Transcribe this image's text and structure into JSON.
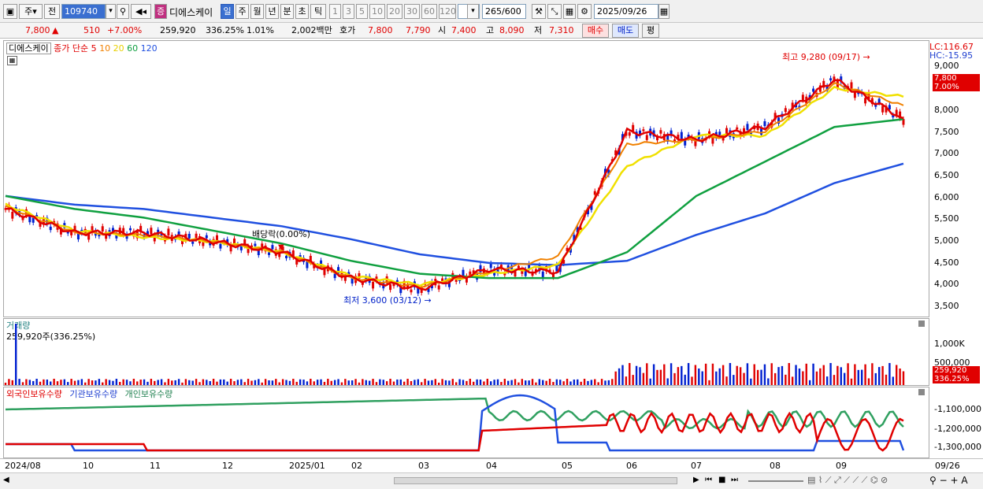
{
  "toolbar": {
    "type1": "주",
    "type2": "전",
    "code": "109740",
    "badge": "증",
    "name": "디에스케이",
    "periods": [
      "일",
      "주",
      "월",
      "년",
      "분",
      "초",
      "틱"
    ],
    "intervals": [
      "1",
      "3",
      "5",
      "10",
      "20",
      "30",
      "60",
      "120"
    ],
    "count": "265",
    "count_total": "/600",
    "date": "2025/09/26"
  },
  "quote": {
    "price": "7,800",
    "arrow": "▲",
    "change": "510",
    "change_pct": "+7.00%",
    "volume": "259,920",
    "volume_pct": "336.25%",
    "turnover": "1.01%",
    "amount": "2,002백만",
    "ask_label": "호가",
    "ask1": "7,800",
    "ask2": "7,790",
    "open_label": "시",
    "open": "7,400",
    "high_label": "고",
    "high": "8,090",
    "low_label": "저",
    "low": "7,310",
    "buy": "매수",
    "sell": "매도",
    "eval": "평"
  },
  "price_panel": {
    "name": "디에스케이",
    "legend_prefix": "종가 단순",
    "ma_periods": [
      "5",
      "10",
      "20",
      "60",
      "120"
    ],
    "lc": "LC:116.67",
    "hc": "HC:-15.95",
    "last_price": "7,800",
    "last_pct": "7.00%",
    "high_note": "최고 9,280 (09/17)",
    "low_note": "최저 3,600 (03/12)",
    "dividend_note": "배당락(0.00%)",
    "y_ticks": [
      "9,000",
      "8,500",
      "8,000",
      "7,500",
      "7,000",
      "6,500",
      "6,000",
      "5,500",
      "5,000",
      "4,500",
      "4,000",
      "3,500"
    ]
  },
  "volume_panel": {
    "title": "거래량",
    "value": "259,920주(336.25%)",
    "y_ticks": [
      "1,000K",
      "500,000"
    ],
    "last": "259,920",
    "last_pct": "336.25%"
  },
  "holding_panel": {
    "legend": [
      "외국인보유수량",
      "기관보유수량",
      "개인보유수량"
    ],
    "y_ticks": [
      "-1,100,000",
      "-1,200,000",
      "-1,300,000"
    ]
  },
  "x_axis": [
    "2024/08",
    "10",
    "11",
    "12",
    "2025/01",
    "02",
    "03",
    "04",
    "05",
    "06",
    "07",
    "08",
    "09",
    "09/26"
  ],
  "colors": {
    "ma5": "#e00000",
    "ma10": "#f08000",
    "ma20": "#f0e000",
    "ma60": "#10a040",
    "ma120": "#2050e0",
    "up": "#e00000",
    "down": "#0020d0"
  },
  "chart_data": {
    "type": "line",
    "title": "",
    "x": [
      "2024/08",
      "10",
      "11",
      "12",
      "2025/01",
      "02",
      "03",
      "04",
      "05",
      "06",
      "07",
      "08",
      "09",
      "09/26"
    ],
    "series": [
      {
        "name": "5",
        "values": [
          5700,
          5150,
          5150,
          4950,
          4700,
          4100,
          3850,
          4300,
          4250,
          7500,
          7300,
          7600,
          8700,
          7800
        ]
      },
      {
        "name": "10",
        "values": [
          5750,
          5150,
          5100,
          4950,
          4700,
          4100,
          3900,
          4250,
          4600,
          7200,
          7300,
          7500,
          8600,
          8100
        ]
      },
      {
        "name": "20",
        "values": [
          5800,
          5200,
          5050,
          4950,
          4700,
          4150,
          3950,
          4200,
          4400,
          6700,
          7400,
          7400,
          8500,
          8300
        ]
      },
      {
        "name": "60",
        "values": [
          6000,
          5700,
          5500,
          5200,
          4900,
          4500,
          4200,
          4100,
          4100,
          4700,
          6000,
          6800,
          7600,
          7780
        ]
      },
      {
        "name": "120",
        "values": [
          6000,
          5800,
          5700,
          5500,
          5300,
          5000,
          4650,
          4450,
          4400,
          4500,
          5100,
          5600,
          6300,
          6750
        ]
      }
    ],
    "ylim": [
      3300,
      9500
    ]
  }
}
